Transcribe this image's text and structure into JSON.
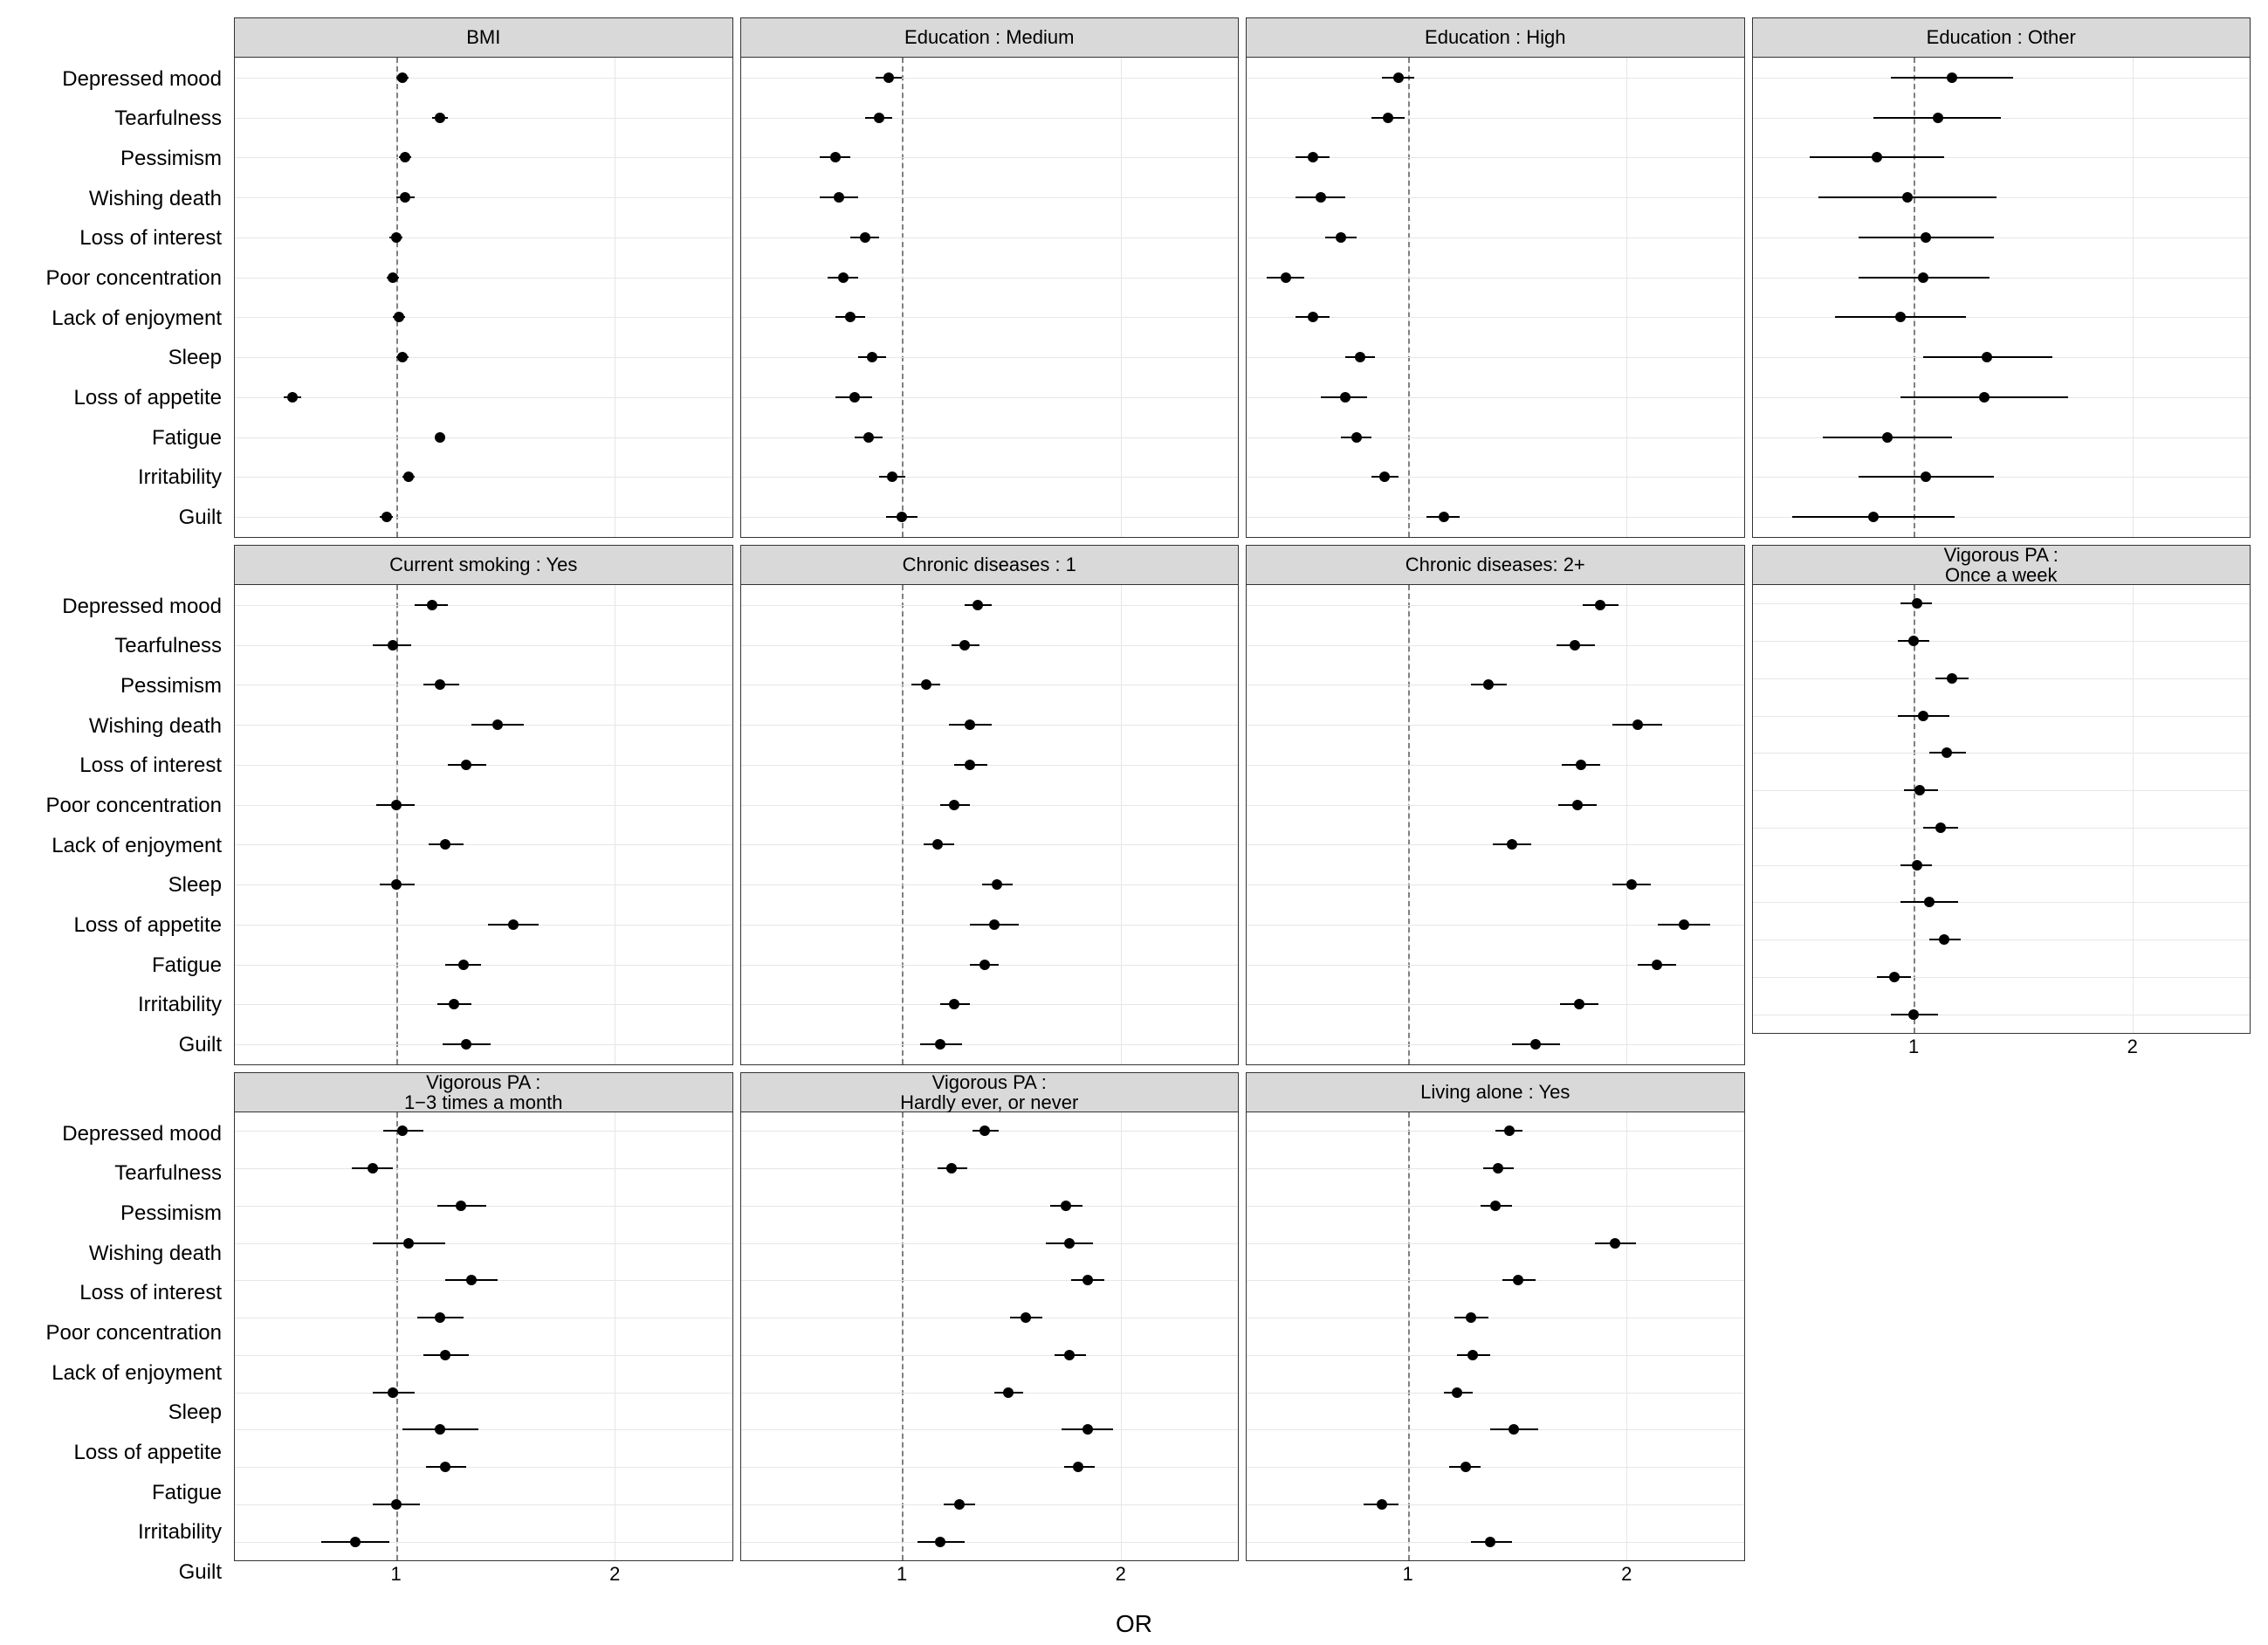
{
  "chart_data": {
    "type": "scatter",
    "xlabel": "OR",
    "xscale": "log",
    "xticks": [
      1,
      2
    ],
    "xlim": [
      0.6,
      2.9
    ],
    "reference_line": 1,
    "categories": [
      "Depressed mood",
      "Tearfulness",
      "Pessimism",
      "Wishing death",
      "Loss of interest",
      "Poor concentration",
      "Lack of enjoyment",
      "Sleep",
      "Loss of appetite",
      "Fatigue",
      "Irritability",
      "Guilt"
    ],
    "panels": [
      {
        "title": "BMI",
        "row": 0,
        "col": 0,
        "points": [
          {
            "or": 1.02,
            "lo": 1.0,
            "hi": 1.04
          },
          {
            "or": 1.15,
            "lo": 1.12,
            "hi": 1.18
          },
          {
            "or": 1.03,
            "lo": 1.01,
            "hi": 1.05
          },
          {
            "or": 1.03,
            "lo": 1.0,
            "hi": 1.06
          },
          {
            "or": 1.0,
            "lo": 0.98,
            "hi": 1.02
          },
          {
            "or": 0.99,
            "lo": 0.97,
            "hi": 1.01
          },
          {
            "or": 1.01,
            "lo": 0.99,
            "hi": 1.03
          },
          {
            "or": 1.02,
            "lo": 1.0,
            "hi": 1.04
          },
          {
            "or": 0.72,
            "lo": 0.7,
            "hi": 0.74
          },
          {
            "or": 1.15,
            "lo": 1.13,
            "hi": 1.17
          },
          {
            "or": 1.04,
            "lo": 1.02,
            "hi": 1.06
          },
          {
            "or": 0.97,
            "lo": 0.95,
            "hi": 0.99
          }
        ]
      },
      {
        "title": "Education : Medium",
        "row": 0,
        "col": 1,
        "points": [
          {
            "or": 0.96,
            "lo": 0.92,
            "hi": 1.0
          },
          {
            "or": 0.93,
            "lo": 0.89,
            "hi": 0.97
          },
          {
            "or": 0.81,
            "lo": 0.77,
            "hi": 0.85
          },
          {
            "or": 0.82,
            "lo": 0.77,
            "hi": 0.87
          },
          {
            "or": 0.89,
            "lo": 0.85,
            "hi": 0.93
          },
          {
            "or": 0.83,
            "lo": 0.79,
            "hi": 0.87
          },
          {
            "or": 0.85,
            "lo": 0.81,
            "hi": 0.89
          },
          {
            "or": 0.91,
            "lo": 0.87,
            "hi": 0.95
          },
          {
            "or": 0.86,
            "lo": 0.81,
            "hi": 0.91
          },
          {
            "or": 0.9,
            "lo": 0.86,
            "hi": 0.94
          },
          {
            "or": 0.97,
            "lo": 0.93,
            "hi": 1.01
          },
          {
            "or": 1.0,
            "lo": 0.95,
            "hi": 1.05
          }
        ]
      },
      {
        "title": "Education : High",
        "row": 0,
        "col": 2,
        "points": [
          {
            "or": 0.97,
            "lo": 0.92,
            "hi": 1.02
          },
          {
            "or": 0.94,
            "lo": 0.89,
            "hi": 0.99
          },
          {
            "or": 0.74,
            "lo": 0.7,
            "hi": 0.78
          },
          {
            "or": 0.76,
            "lo": 0.7,
            "hi": 0.82
          },
          {
            "or": 0.81,
            "lo": 0.77,
            "hi": 0.85
          },
          {
            "or": 0.68,
            "lo": 0.64,
            "hi": 0.72
          },
          {
            "or": 0.74,
            "lo": 0.7,
            "hi": 0.78
          },
          {
            "or": 0.86,
            "lo": 0.82,
            "hi": 0.9
          },
          {
            "or": 0.82,
            "lo": 0.76,
            "hi": 0.88
          },
          {
            "or": 0.85,
            "lo": 0.81,
            "hi": 0.89
          },
          {
            "or": 0.93,
            "lo": 0.89,
            "hi": 0.97
          },
          {
            "or": 1.12,
            "lo": 1.06,
            "hi": 1.18
          }
        ]
      },
      {
        "title": "Education : Other",
        "row": 0,
        "col": 3,
        "points": [
          {
            "or": 1.13,
            "lo": 0.93,
            "hi": 1.37
          },
          {
            "or": 1.08,
            "lo": 0.88,
            "hi": 1.32
          },
          {
            "or": 0.89,
            "lo": 0.72,
            "hi": 1.1
          },
          {
            "or": 0.98,
            "lo": 0.74,
            "hi": 1.3
          },
          {
            "or": 1.04,
            "lo": 0.84,
            "hi": 1.29
          },
          {
            "or": 1.03,
            "lo": 0.84,
            "hi": 1.27
          },
          {
            "or": 0.96,
            "lo": 0.78,
            "hi": 1.18
          },
          {
            "or": 1.26,
            "lo": 1.03,
            "hi": 1.55
          },
          {
            "or": 1.25,
            "lo": 0.96,
            "hi": 1.63
          },
          {
            "or": 0.92,
            "lo": 0.75,
            "hi": 1.13
          },
          {
            "or": 1.04,
            "lo": 0.84,
            "hi": 1.29
          },
          {
            "or": 0.88,
            "lo": 0.68,
            "hi": 1.14
          }
        ]
      },
      {
        "title": "Current smoking : Yes",
        "row": 1,
        "col": 0,
        "points": [
          {
            "or": 1.12,
            "lo": 1.06,
            "hi": 1.18
          },
          {
            "or": 0.99,
            "lo": 0.93,
            "hi": 1.05
          },
          {
            "or": 1.15,
            "lo": 1.09,
            "hi": 1.22
          },
          {
            "or": 1.38,
            "lo": 1.27,
            "hi": 1.5
          },
          {
            "or": 1.25,
            "lo": 1.18,
            "hi": 1.33
          },
          {
            "or": 1.0,
            "lo": 0.94,
            "hi": 1.06
          },
          {
            "or": 1.17,
            "lo": 1.11,
            "hi": 1.24
          },
          {
            "or": 1.0,
            "lo": 0.95,
            "hi": 1.06
          },
          {
            "or": 1.45,
            "lo": 1.34,
            "hi": 1.57
          },
          {
            "or": 1.24,
            "lo": 1.17,
            "hi": 1.31
          },
          {
            "or": 1.2,
            "lo": 1.14,
            "hi": 1.27
          },
          {
            "or": 1.25,
            "lo": 1.16,
            "hi": 1.35
          }
        ]
      },
      {
        "title": "Chronic diseases : 1",
        "row": 1,
        "col": 1,
        "points": [
          {
            "or": 1.27,
            "lo": 1.22,
            "hi": 1.33
          },
          {
            "or": 1.22,
            "lo": 1.17,
            "hi": 1.28
          },
          {
            "or": 1.08,
            "lo": 1.03,
            "hi": 1.13
          },
          {
            "or": 1.24,
            "lo": 1.16,
            "hi": 1.33
          },
          {
            "or": 1.24,
            "lo": 1.18,
            "hi": 1.31
          },
          {
            "or": 1.18,
            "lo": 1.13,
            "hi": 1.24
          },
          {
            "or": 1.12,
            "lo": 1.07,
            "hi": 1.18
          },
          {
            "or": 1.35,
            "lo": 1.29,
            "hi": 1.42
          },
          {
            "or": 1.34,
            "lo": 1.24,
            "hi": 1.45
          },
          {
            "or": 1.3,
            "lo": 1.24,
            "hi": 1.36
          },
          {
            "or": 1.18,
            "lo": 1.13,
            "hi": 1.24
          },
          {
            "or": 1.13,
            "lo": 1.06,
            "hi": 1.21
          }
        ]
      },
      {
        "title": "Chronic diseases: 2+",
        "row": 1,
        "col": 2,
        "points": [
          {
            "or": 1.84,
            "lo": 1.74,
            "hi": 1.95
          },
          {
            "or": 1.7,
            "lo": 1.6,
            "hi": 1.81
          },
          {
            "or": 1.29,
            "lo": 1.22,
            "hi": 1.37
          },
          {
            "or": 2.07,
            "lo": 1.91,
            "hi": 2.24
          },
          {
            "or": 1.73,
            "lo": 1.63,
            "hi": 1.84
          },
          {
            "or": 1.71,
            "lo": 1.61,
            "hi": 1.82
          },
          {
            "or": 1.39,
            "lo": 1.31,
            "hi": 1.48
          },
          {
            "or": 2.03,
            "lo": 1.91,
            "hi": 2.16
          },
          {
            "or": 2.4,
            "lo": 2.21,
            "hi": 2.61
          },
          {
            "or": 2.2,
            "lo": 2.07,
            "hi": 2.34
          },
          {
            "or": 1.72,
            "lo": 1.62,
            "hi": 1.83
          },
          {
            "or": 1.5,
            "lo": 1.39,
            "hi": 1.62
          }
        ]
      },
      {
        "title": "Vigorous PA :\nOnce a week",
        "row": 1,
        "col": 3,
        "short": true,
        "points": [
          {
            "or": 1.01,
            "lo": 0.96,
            "hi": 1.06
          },
          {
            "or": 1.0,
            "lo": 0.95,
            "hi": 1.05
          },
          {
            "or": 1.13,
            "lo": 1.07,
            "hi": 1.19
          },
          {
            "or": 1.03,
            "lo": 0.95,
            "hi": 1.12
          },
          {
            "or": 1.11,
            "lo": 1.05,
            "hi": 1.18
          },
          {
            "or": 1.02,
            "lo": 0.97,
            "hi": 1.08
          },
          {
            "or": 1.09,
            "lo": 1.03,
            "hi": 1.15
          },
          {
            "or": 1.01,
            "lo": 0.96,
            "hi": 1.06
          },
          {
            "or": 1.05,
            "lo": 0.96,
            "hi": 1.15
          },
          {
            "or": 1.1,
            "lo": 1.05,
            "hi": 1.16
          },
          {
            "or": 0.94,
            "lo": 0.89,
            "hi": 0.99
          },
          {
            "or": 1.0,
            "lo": 0.93,
            "hi": 1.08
          }
        ]
      },
      {
        "title": "Vigorous PA :\n1−3 times a month",
        "row": 2,
        "col": 0,
        "points": [
          {
            "or": 1.02,
            "lo": 0.96,
            "hi": 1.09
          },
          {
            "or": 0.93,
            "lo": 0.87,
            "hi": 0.99
          },
          {
            "or": 1.23,
            "lo": 1.14,
            "hi": 1.33
          },
          {
            "or": 1.04,
            "lo": 0.93,
            "hi": 1.17
          },
          {
            "or": 1.27,
            "lo": 1.17,
            "hi": 1.38
          },
          {
            "or": 1.15,
            "lo": 1.07,
            "hi": 1.24
          },
          {
            "or": 1.17,
            "lo": 1.09,
            "hi": 1.26
          },
          {
            "or": 0.99,
            "lo": 0.93,
            "hi": 1.06
          },
          {
            "or": 1.15,
            "lo": 1.02,
            "hi": 1.3
          },
          {
            "or": 1.17,
            "lo": 1.1,
            "hi": 1.25
          },
          {
            "or": 1.0,
            "lo": 0.93,
            "hi": 1.08
          },
          {
            "or": 0.88,
            "lo": 0.79,
            "hi": 0.98
          }
        ]
      },
      {
        "title": "Vigorous PA :\nHardly ever, or never",
        "row": 2,
        "col": 1,
        "points": [
          {
            "or": 1.3,
            "lo": 1.25,
            "hi": 1.36
          },
          {
            "or": 1.17,
            "lo": 1.12,
            "hi": 1.23
          },
          {
            "or": 1.68,
            "lo": 1.6,
            "hi": 1.77
          },
          {
            "or": 1.7,
            "lo": 1.58,
            "hi": 1.83
          },
          {
            "or": 1.8,
            "lo": 1.71,
            "hi": 1.9
          },
          {
            "or": 1.48,
            "lo": 1.41,
            "hi": 1.56
          },
          {
            "or": 1.7,
            "lo": 1.62,
            "hi": 1.79
          },
          {
            "or": 1.4,
            "lo": 1.34,
            "hi": 1.47
          },
          {
            "or": 1.8,
            "lo": 1.66,
            "hi": 1.95
          },
          {
            "or": 1.75,
            "lo": 1.67,
            "hi": 1.84
          },
          {
            "or": 1.2,
            "lo": 1.14,
            "hi": 1.26
          },
          {
            "or": 1.13,
            "lo": 1.05,
            "hi": 1.22
          }
        ]
      },
      {
        "title": "Living alone : Yes",
        "row": 2,
        "col": 2,
        "points": [
          {
            "or": 1.38,
            "lo": 1.32,
            "hi": 1.44
          },
          {
            "or": 1.33,
            "lo": 1.27,
            "hi": 1.4
          },
          {
            "or": 1.32,
            "lo": 1.26,
            "hi": 1.39
          },
          {
            "or": 1.93,
            "lo": 1.81,
            "hi": 2.06
          },
          {
            "or": 1.42,
            "lo": 1.35,
            "hi": 1.5
          },
          {
            "or": 1.22,
            "lo": 1.16,
            "hi": 1.29
          },
          {
            "or": 1.23,
            "lo": 1.17,
            "hi": 1.3
          },
          {
            "or": 1.17,
            "lo": 1.12,
            "hi": 1.23
          },
          {
            "or": 1.4,
            "lo": 1.3,
            "hi": 1.51
          },
          {
            "or": 1.2,
            "lo": 1.14,
            "hi": 1.26
          },
          {
            "or": 0.92,
            "lo": 0.87,
            "hi": 0.97
          },
          {
            "or": 1.3,
            "lo": 1.22,
            "hi": 1.39
          }
        ]
      }
    ]
  }
}
